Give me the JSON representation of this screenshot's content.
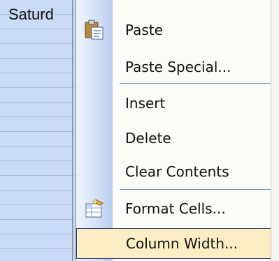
{
  "sheet": {
    "column_header_text": "Saturd"
  },
  "context_menu": {
    "items": [
      {
        "label": "Paste",
        "icon": "clipboard-paste-icon"
      },
      {
        "label": "Paste Special..."
      },
      {
        "label": "Insert"
      },
      {
        "label": "Delete"
      },
      {
        "label": "Clear Contents"
      },
      {
        "label": "Format Cells...",
        "icon": "format-cells-icon"
      },
      {
        "label": "Column Width...",
        "highlighted": true
      }
    ]
  },
  "colors": {
    "highlight_fill": "#fbeec4",
    "highlight_border": "#2d3a64",
    "separator": "#7d98c3",
    "sheet_bg": "#c9dbf5"
  }
}
